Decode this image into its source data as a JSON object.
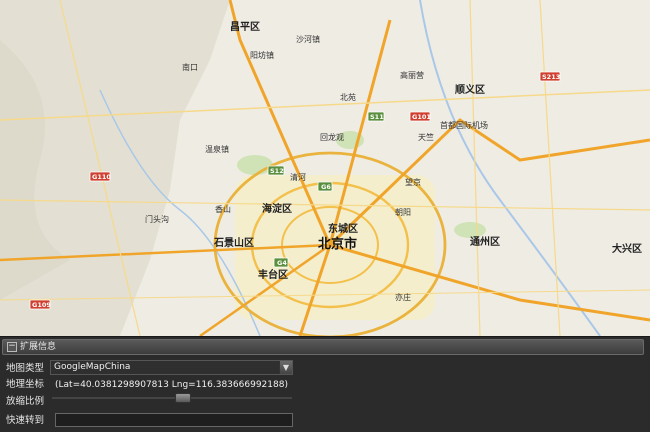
{
  "map": {
    "city_label": "北京市",
    "district_labels": [
      "海淀区",
      "东城区",
      "石景山区",
      "丰台区",
      "昌平区",
      "顺义区",
      "通州区",
      "大兴区"
    ],
    "town_labels": [
      "阳坊镇",
      "沙河镇",
      "首都国际机场",
      "回龙观",
      "清河",
      "望京",
      "朝阳",
      "亦庄",
      "门头沟",
      "香山",
      "北苑",
      "温泉镇",
      "南口",
      "高丽营",
      "天竺"
    ],
    "road_shields": [
      "G6",
      "G4",
      "S12",
      "S11",
      "G110",
      "G101",
      "G109",
      "S213"
    ]
  },
  "panel": {
    "title": "扩展信息",
    "map_type_label": "地图类型",
    "map_type_value": "GoogleMapChina",
    "coord_label": "地理坐标",
    "coord_value": "(Lat=40.0381298907813  Lng=116.383666992188)",
    "zoom_label": "放缩比例",
    "zoom_level": 0.55,
    "goto_label": "快速转到",
    "goto_value": ""
  }
}
